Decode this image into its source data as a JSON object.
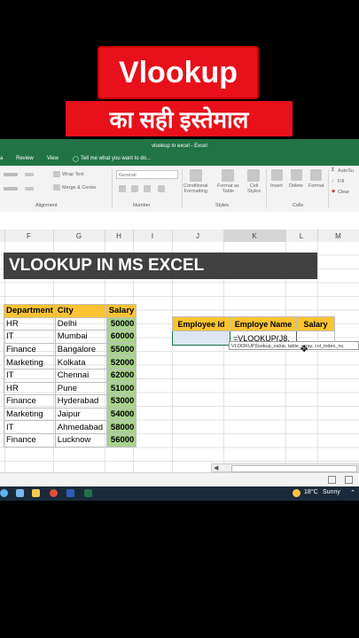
{
  "overlay": {
    "title": "Vlookup",
    "subtitle": "का सही इस्तेमाल"
  },
  "excel": {
    "window_title": "vlookup in excel - Excel",
    "menu": [
      "Review",
      "View",
      "Tell me what you want to do..."
    ],
    "ribbon": {
      "wrap_text": "Wrap Text",
      "merge_center": "Merge & Center",
      "number_format": "General",
      "conditional_formatting": "Conditional\nFormatting",
      "format_as_table": "Format as\nTable",
      "cell_styles": "Cell\nStyles",
      "insert": "Insert",
      "delete": "Delete",
      "format": "Format",
      "autosum": "AutoSu",
      "fill": "Fill",
      "clear": "Clear",
      "groups": [
        "Alignment",
        "Number",
        "Styles",
        "Cells"
      ]
    },
    "columns": [
      "F",
      "G",
      "H",
      "I",
      "J",
      "K",
      "L",
      "M"
    ],
    "heading": "VLOOKUP IN MS EXCEL",
    "table": {
      "headers": [
        "Department",
        "City",
        "Salary"
      ],
      "rows": [
        [
          "HR",
          "Delhi",
          "50000"
        ],
        [
          "IT",
          "Mumbai",
          "60000"
        ],
        [
          "Finance",
          "Bangalore",
          "55000"
        ],
        [
          "Marketing",
          "Kolkata",
          "52000"
        ],
        [
          "IT",
          "Chennai",
          "62000"
        ],
        [
          "HR",
          "Pune",
          "51000"
        ],
        [
          "Finance",
          "Hyderabad",
          "53000"
        ],
        [
          "Marketing",
          "Jaipur",
          "54000"
        ],
        [
          "IT",
          "Ahmedabad",
          "58000"
        ],
        [
          "Finance",
          "Lucknow",
          "56000"
        ]
      ]
    },
    "lookup": {
      "headers": [
        "Employee Id",
        "Employe Name",
        "Salary"
      ],
      "formula": "=VLOOKUP(J8,",
      "tooltip": "VLOOKUP(lookup_value, table_array, col_index_nu"
    },
    "taskbar": {
      "temperature": "18°C",
      "weather": "Sunny"
    }
  },
  "colors": {
    "banner_red": "#e8101a",
    "excel_green": "#217346",
    "header_yellow": "#fcc332",
    "salary_green": "#a9d18e",
    "heading_dark": "#404040"
  }
}
